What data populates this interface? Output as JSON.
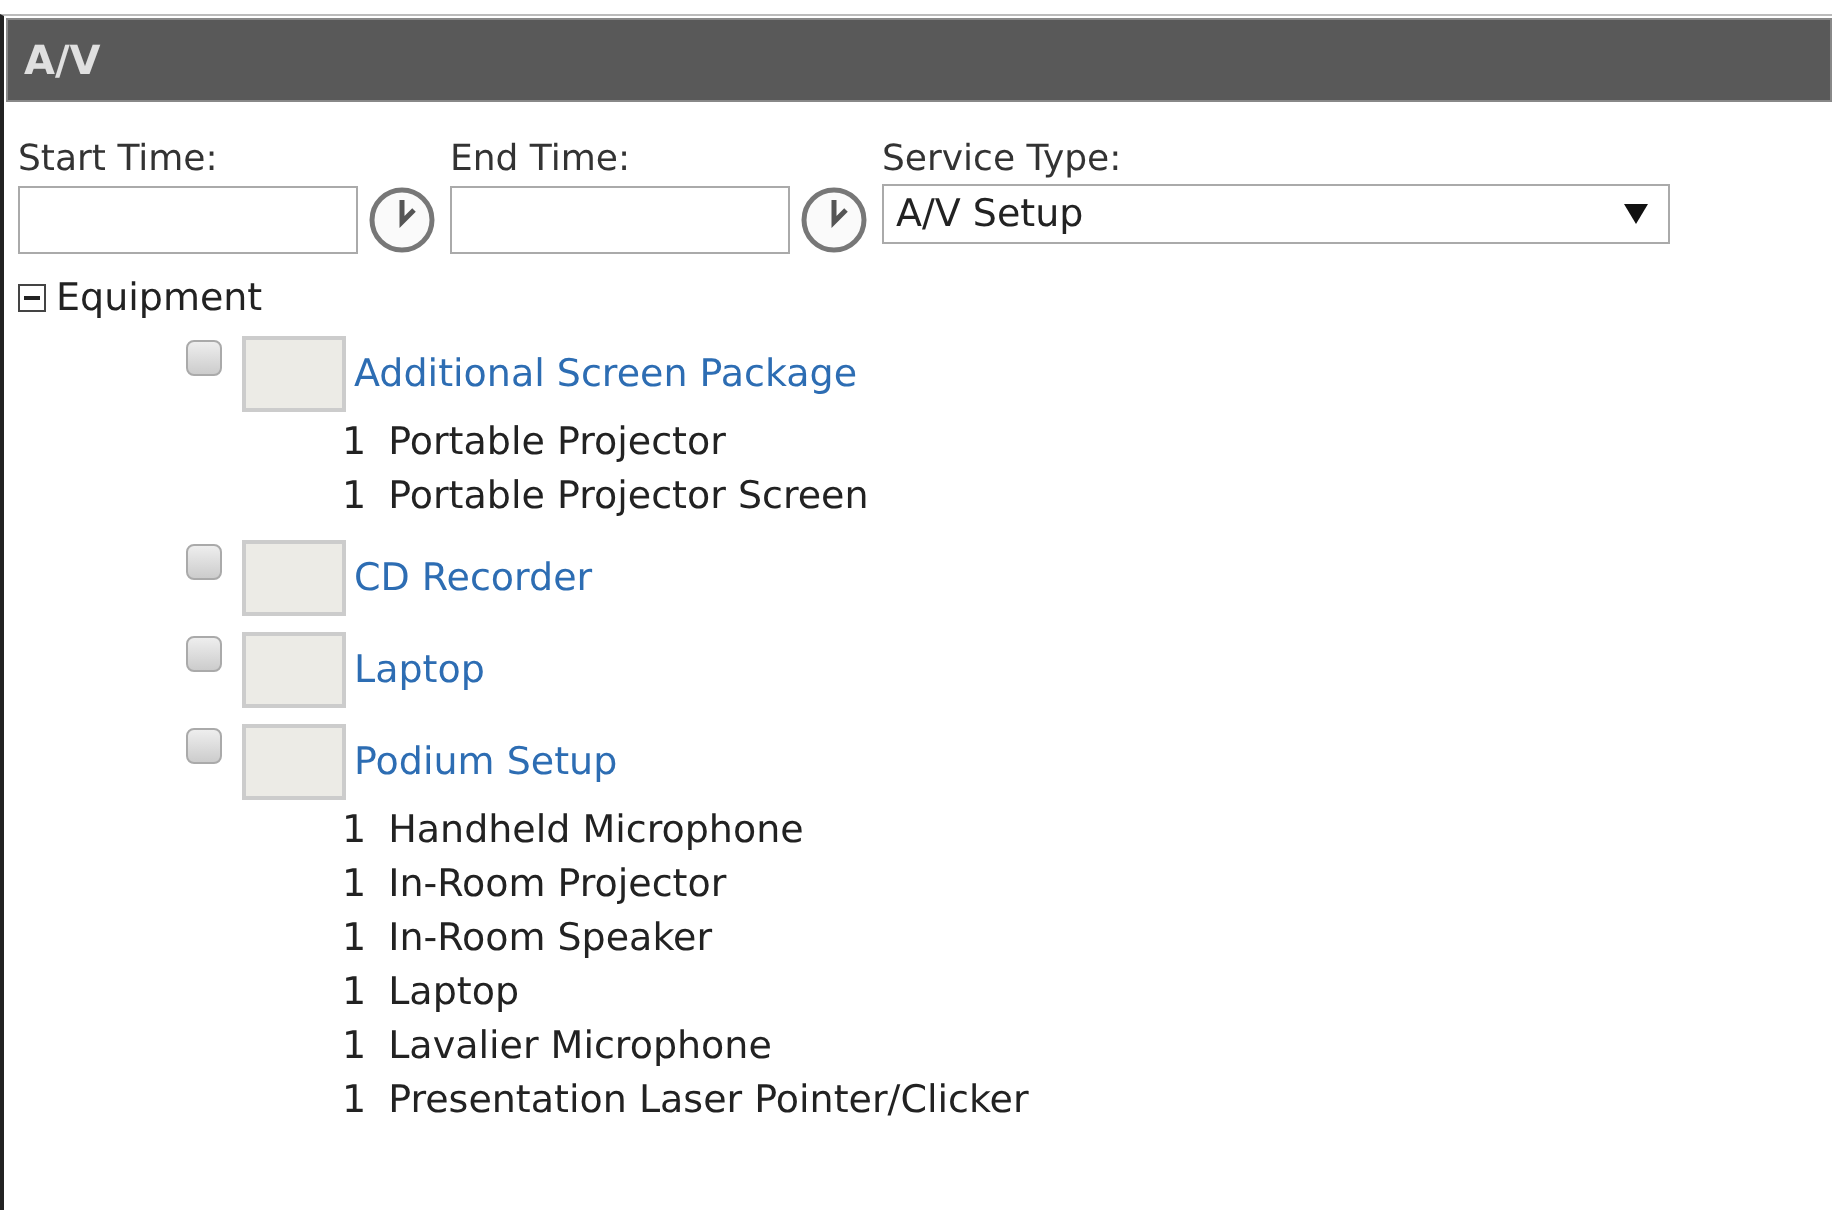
{
  "panel": {
    "title": "A/V"
  },
  "fields": [
    {
      "kind": "time",
      "label": "Start Time:"
    },
    {
      "kind": "time",
      "label": "End Time:"
    },
    {
      "kind": "select",
      "label": "Service Type:",
      "value": "A/V Setup"
    }
  ],
  "tree": {
    "label": "Equipment",
    "expanded": true,
    "items": [
      {
        "name": "Additional Screen Package",
        "checked": false,
        "contents": [
          {
            "qty": "1",
            "name": "Portable Projector"
          },
          {
            "qty": "1",
            "name": "Portable Projector Screen"
          }
        ]
      },
      {
        "name": "CD Recorder",
        "checked": false
      },
      {
        "name": "Laptop",
        "checked": false
      },
      {
        "name": "Podium Setup",
        "checked": false,
        "contents": [
          {
            "qty": "1",
            "name": "Handheld Microphone"
          },
          {
            "qty": "1",
            "name": "In-Room Projector"
          },
          {
            "qty": "1",
            "name": "In-Room Speaker"
          },
          {
            "qty": "1",
            "name": "Laptop"
          },
          {
            "qty": "1",
            "name": "Lavalier Microphone"
          },
          {
            "qty": "1",
            "name": "Presentation Laser Pointer/Clicker"
          }
        ]
      }
    ]
  }
}
